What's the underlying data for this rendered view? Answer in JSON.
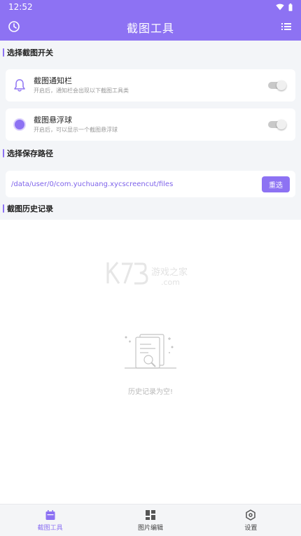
{
  "status_bar": {
    "time": "12:52"
  },
  "header": {
    "title": "截图工具",
    "left_icon": "history-clock-icon",
    "right_icon": "list-menu-icon"
  },
  "sections": {
    "switches_title": "选择截图开关",
    "path_title": "选择保存路径",
    "history_title": "截图历史记录"
  },
  "switches": [
    {
      "title": "截图通知栏",
      "desc": "开启后，通知栏会出现以下截图工具类",
      "icon": "bell-icon",
      "enabled": false
    },
    {
      "title": "截图悬浮球",
      "desc": "开启后，可以显示一个截图悬浮球",
      "icon": "float-ball-icon",
      "enabled": false
    }
  ],
  "save_path": {
    "value": "/data/user/0/com.yuchuang.xycscreencut/files",
    "button": "重选"
  },
  "history": {
    "empty_text": "历史记录为空!",
    "watermark": "K73 游戏之家 .com"
  },
  "bottom_nav": [
    {
      "label": "截图工具",
      "icon": "calendar-icon",
      "active": true
    },
    {
      "label": "图片编辑",
      "icon": "grid-icon",
      "active": false
    },
    {
      "label": "设置",
      "icon": "settings-icon",
      "active": false
    }
  ],
  "colors": {
    "accent": "#8d72f3",
    "background": "#f3f5f8"
  }
}
